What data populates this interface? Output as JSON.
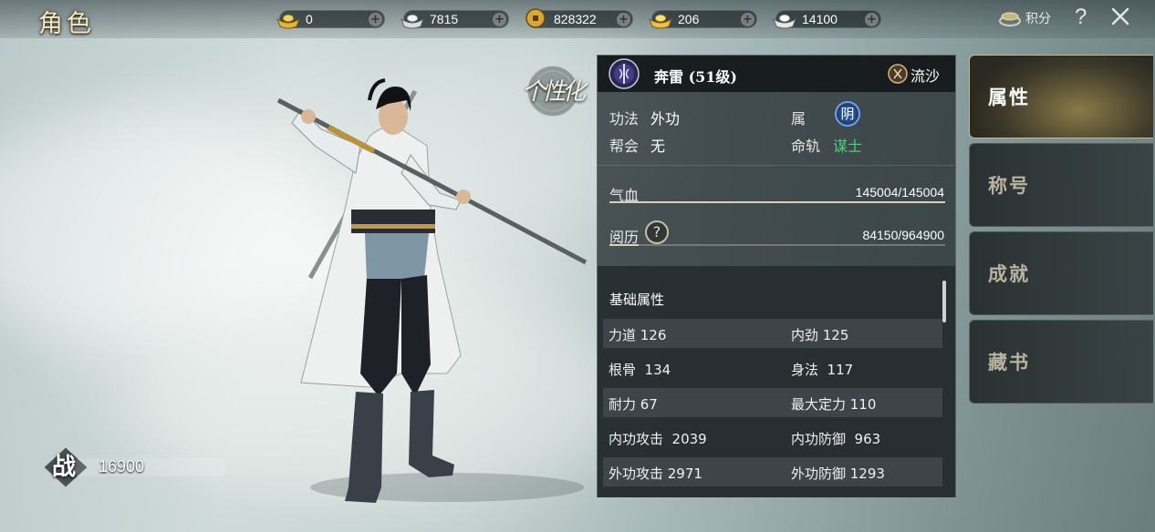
{
  "header": {
    "title": "角色",
    "currencies": [
      {
        "icon": "gold-ingot-icon",
        "value": "0"
      },
      {
        "icon": "silver-ingot-icon",
        "value": "7815"
      },
      {
        "icon": "copper-coin-icon",
        "value": "828322"
      },
      {
        "icon": "gold-ingot-bound-icon",
        "value": "206"
      },
      {
        "icon": "silver-ingot-bound-icon",
        "value": "14100"
      }
    ],
    "points_label": "积分",
    "help_label": "?"
  },
  "character": {
    "power_label": "战",
    "power_value": "16900",
    "customize_label": "个性化"
  },
  "panel": {
    "name": "奔雷 (51级)",
    "faction": "流沙",
    "info": {
      "school_label": "功法",
      "school_value": "外功",
      "attribute_label": "属",
      "attribute_value": "阴",
      "guild_label": "帮会",
      "guild_value": "无",
      "destiny_label": "命轨",
      "destiny_value": "谋士"
    },
    "hp": {
      "label": "气血",
      "value": "145004/145004",
      "fraction": 1.0
    },
    "exp": {
      "label": "阅历",
      "value": "84150/964900",
      "fraction": 0.087
    },
    "base_title": "基础属性",
    "stats": [
      {
        "left": "力道 126",
        "right": "内劲 125"
      },
      {
        "left": "根骨  134",
        "right": "身法  117"
      },
      {
        "left": "耐力 67",
        "right": "最大定力 110"
      },
      {
        "left": "内功攻击  2039",
        "right": "内功防御  963"
      },
      {
        "left": "外功攻击 2971",
        "right": "外功防御 1293"
      }
    ]
  },
  "tabs": [
    {
      "label": "属性",
      "active": true
    },
    {
      "label": "称号",
      "active": false
    },
    {
      "label": "成就",
      "active": false
    },
    {
      "label": "藏书",
      "active": false
    }
  ],
  "colors": {
    "destiny": "#4fd07a",
    "attribute_badge": "#2a56a0",
    "active_tab": "#8a7a48"
  }
}
